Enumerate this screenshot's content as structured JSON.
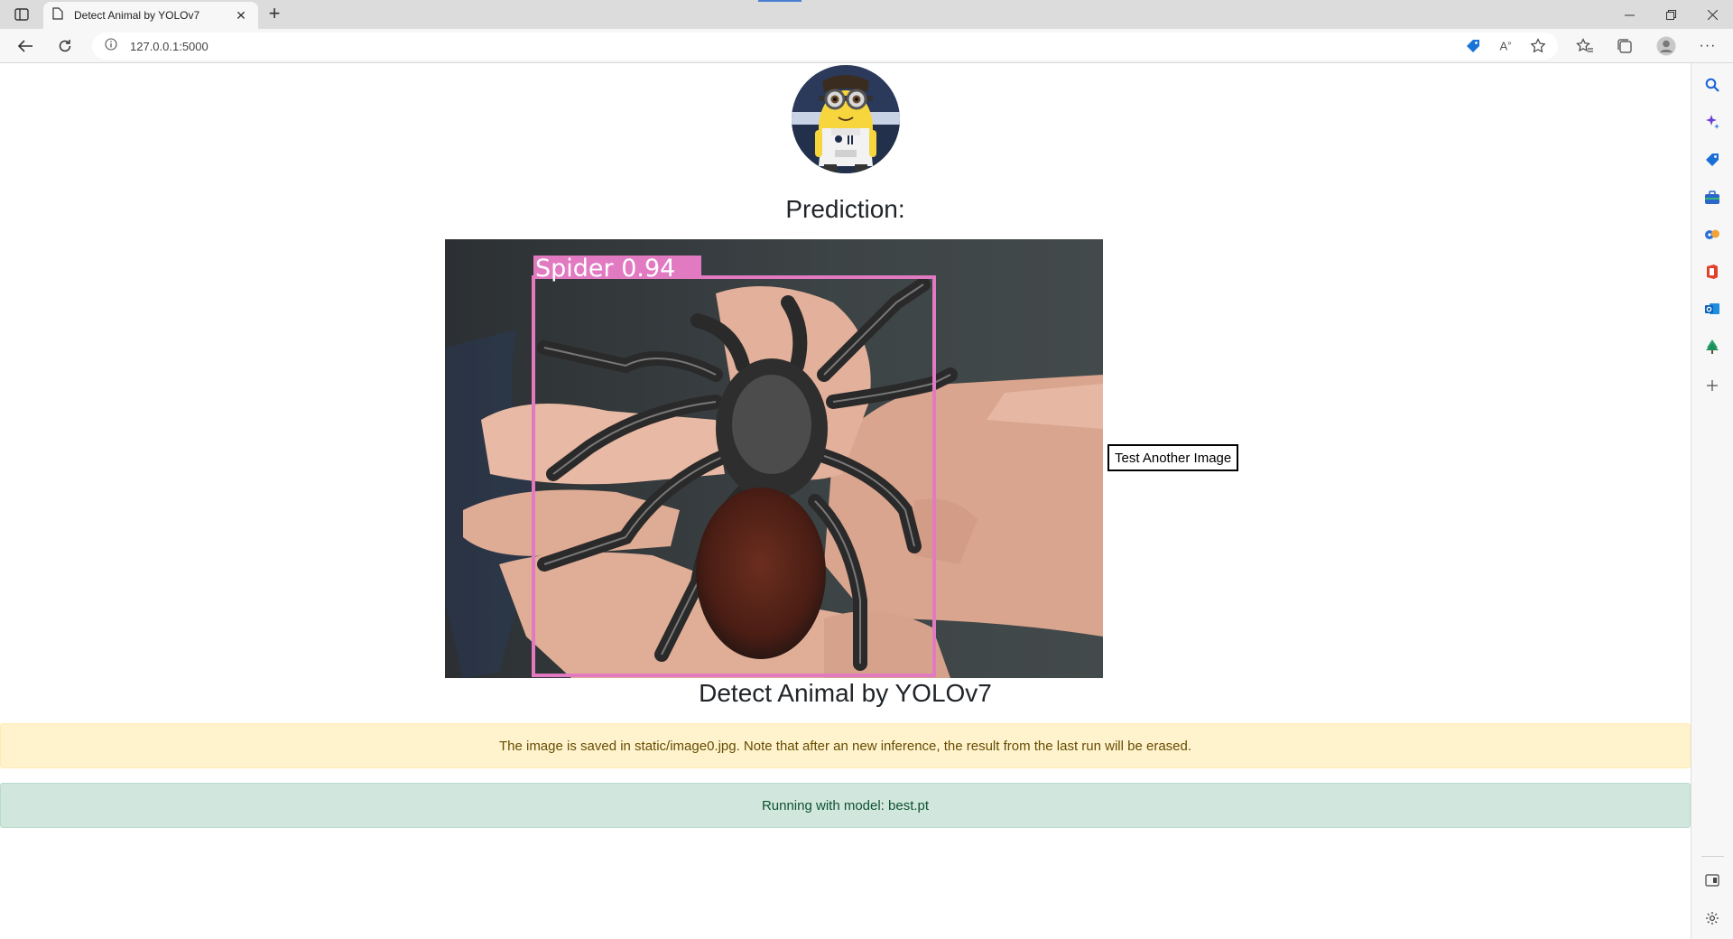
{
  "browser": {
    "tab_title": "Detect Animal by YOLOv7",
    "url": "127.0.0.1:5000"
  },
  "page": {
    "prediction_heading": "Prediction:",
    "detection_label": "Spider  0.94",
    "test_button": "Test Another Image",
    "app_title": "Detect Animal by YOLOv7",
    "warning_text": "The image is saved in static/image0.jpg. Note that after an new inference, the result from the last run will be erased.",
    "success_text": "Running with model: best.pt"
  },
  "colors": {
    "bounding_box": "#e27ac2",
    "warning_bg": "#fff3cd",
    "success_bg": "#d1e7dd"
  },
  "icons": {
    "sidebar": [
      "search-icon",
      "copilot-icon",
      "shopping-icon",
      "tools-icon",
      "games-icon",
      "office-icon",
      "outlook-icon",
      "tree-icon",
      "add-icon",
      "split-screen-icon",
      "settings-icon"
    ]
  }
}
